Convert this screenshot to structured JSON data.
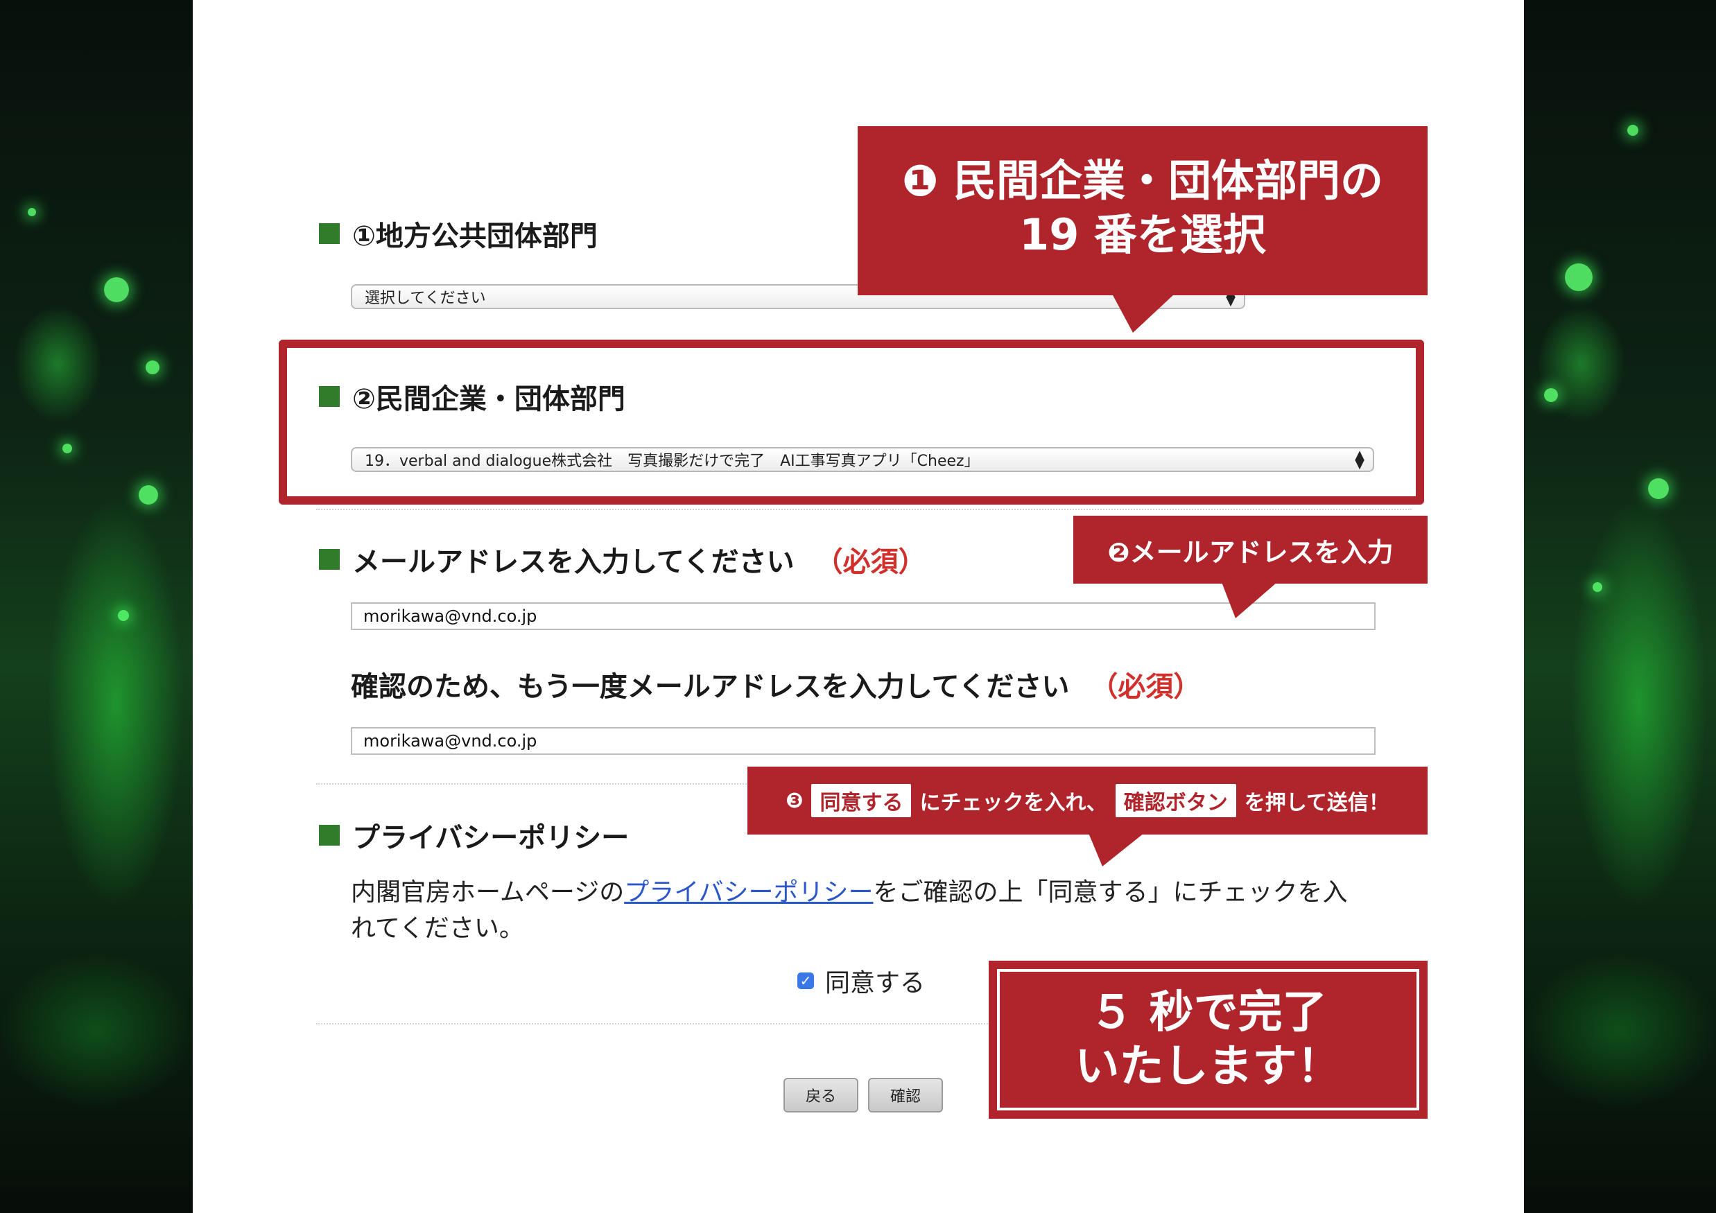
{
  "sections": {
    "local_gov": {
      "title": "①地方公共団体部門",
      "select_value": "選択してください"
    },
    "private": {
      "title": "②民間企業・団体部門",
      "select_value": "19．verbal and dialogue株式会社　写真撮影だけで完了　AI工事写真アプリ「Cheez」"
    },
    "email": {
      "title": "メールアドレスを入力してください",
      "required": "（必須）",
      "value": "morikawa@vnd.co.jp",
      "confirm_title": "確認のため、もう一度メールアドレスを入力してください",
      "confirm_required": "（必須）",
      "confirm_value": "morikawa@vnd.co.jp"
    },
    "privacy": {
      "title": "プライバシーポリシー",
      "text_before": "内閣官房ホームページの",
      "link": "プライバシーポリシー",
      "text_after": "をご確認の上「同意する」にチェックを入れてください。",
      "checkbox_label": "同意する",
      "checked": true
    }
  },
  "buttons": {
    "back": "戻る",
    "confirm": "確認"
  },
  "callouts": {
    "step1_line1": "❶ 民間企業・団体部門の",
    "step1_line2": "19 番を選択",
    "step2": "❷メールアドレスを入力",
    "step3_num": "❸",
    "step3_chip1": "同意する",
    "step3_mid": "にチェックを入れ、",
    "step3_chip2": "確認ボタン",
    "step3_end": "を押して送信！",
    "done_line1": "５ 秒で完了",
    "done_line2": "いたします！"
  },
  "colors": {
    "accent_red": "#b0252b",
    "section_green": "#2f7d2a",
    "required_red": "#d0312d",
    "link_blue": "#2b57c9"
  }
}
